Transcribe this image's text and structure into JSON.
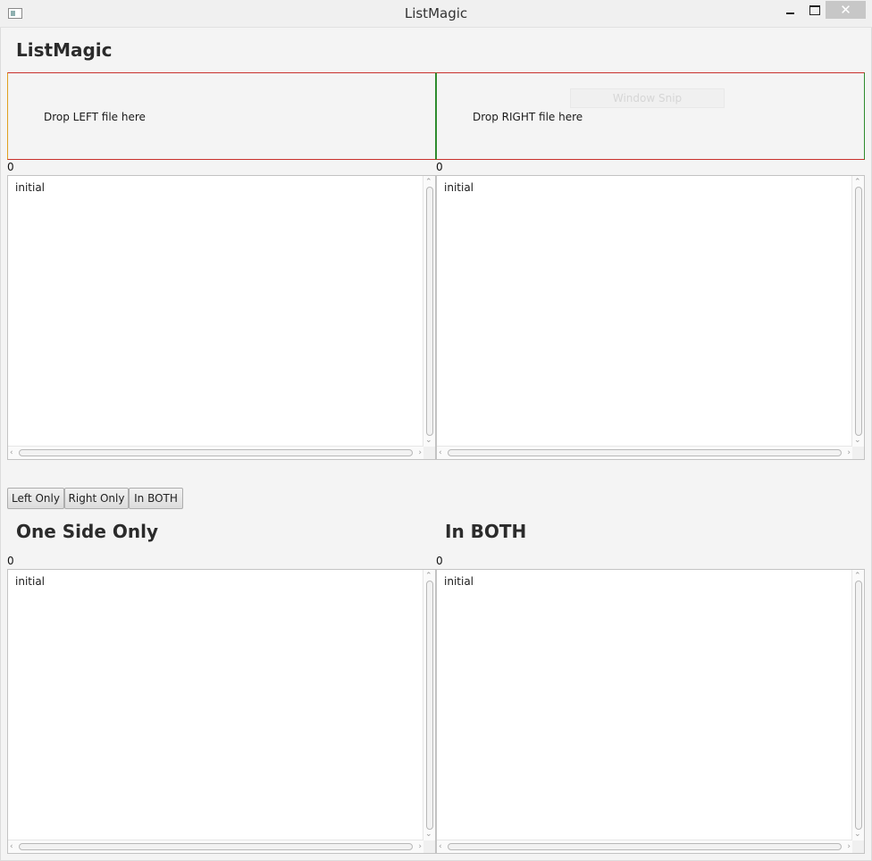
{
  "window": {
    "title": "ListMagic",
    "close_glyph": "✕"
  },
  "header": {
    "title": "ListMagic"
  },
  "drop_zones": {
    "left_label": "Drop LEFT file here",
    "right_label": "Drop RIGHT file here"
  },
  "overlay": {
    "snip_label": "Window Snip"
  },
  "top_lists": {
    "left": {
      "count": "0",
      "items": [
        "initial"
      ]
    },
    "right": {
      "count": "0",
      "items": [
        "initial"
      ]
    }
  },
  "filter_buttons": {
    "left_only": "Left Only",
    "right_only": "Right Only",
    "in_both": "In BOTH"
  },
  "results": {
    "one_side": {
      "title": "One Side Only",
      "count": "0",
      "items": [
        "initial"
      ]
    },
    "both": {
      "title": "In BOTH",
      "count": "0",
      "items": [
        "initial"
      ]
    }
  },
  "scroll_glyphs": {
    "up": "⌃",
    "down": "⌄",
    "left": "‹",
    "right": "›"
  }
}
